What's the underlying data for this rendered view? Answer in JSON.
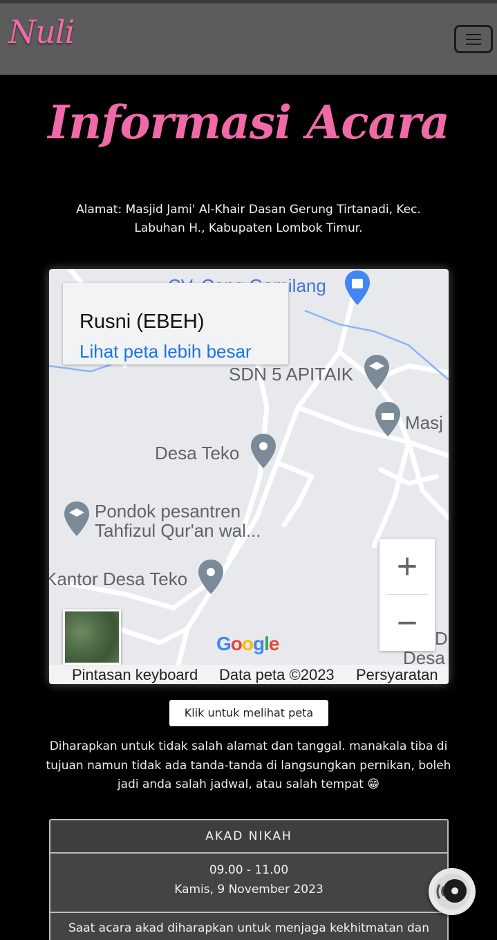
{
  "navbar": {
    "brand": "Nuli",
    "menu_icon": "hamburger-icon"
  },
  "section": {
    "title": "Informasi Acara",
    "address": "Alamat: Masjid Jami' Al-Khair Dasan Gerung Tirtanadi, Kec. Labuhan H., Kabupaten Lombok Timur."
  },
  "map": {
    "place_name": "Rusni (EBEH)",
    "larger_map_link": "Lihat peta lebih besar",
    "labels": {
      "cv": "CV. Cang  Gemilang",
      "sdn": "SDN 5 APITAIK",
      "masjid": "Masj",
      "desa_teko": "Desa Teko",
      "pondok_line1": "Pondok pesantren",
      "pondok_line2": "Tahfizul Qur'an wal...",
      "kantor": "Kantor Desa Teko",
      "edge_d": "D",
      "edge_desa": "Desa"
    },
    "zoom_in": "+",
    "zoom_out": "−",
    "google_logo": "Google",
    "footer": {
      "shortcuts": "Pintasan keyboard",
      "data": "Data peta ©2023",
      "terms": "Persyaratan"
    },
    "colors": {
      "background": "#e7e9ec",
      "road": "#ffffff",
      "water": "#8ab4f8",
      "pin": "#7b8a99"
    }
  },
  "map_button": "Klik untuk melihat peta",
  "note": "Diharapkan untuk tidak salah alamat dan tanggal. manakala tiba di tujuan namun tidak ada tanda-tanda di langsungkan pernikan, boleh jadi anda salah jadwal, atau salah tempat 😁",
  "event_card": {
    "heading": "AKAD NIKAH",
    "time": "09.00 - 11.00",
    "date": "Kamis, 9 November 2023",
    "description": "Saat acara akad diharapkan untuk menjaga kekhitmatan dan"
  },
  "music_button_icon": "vinyl-disc-icon",
  "colors": {
    "accent_pink": "#f06aa8",
    "navbar": "#5c5c5c",
    "page_bg": "#000000",
    "link_blue": "#1a73e8"
  }
}
